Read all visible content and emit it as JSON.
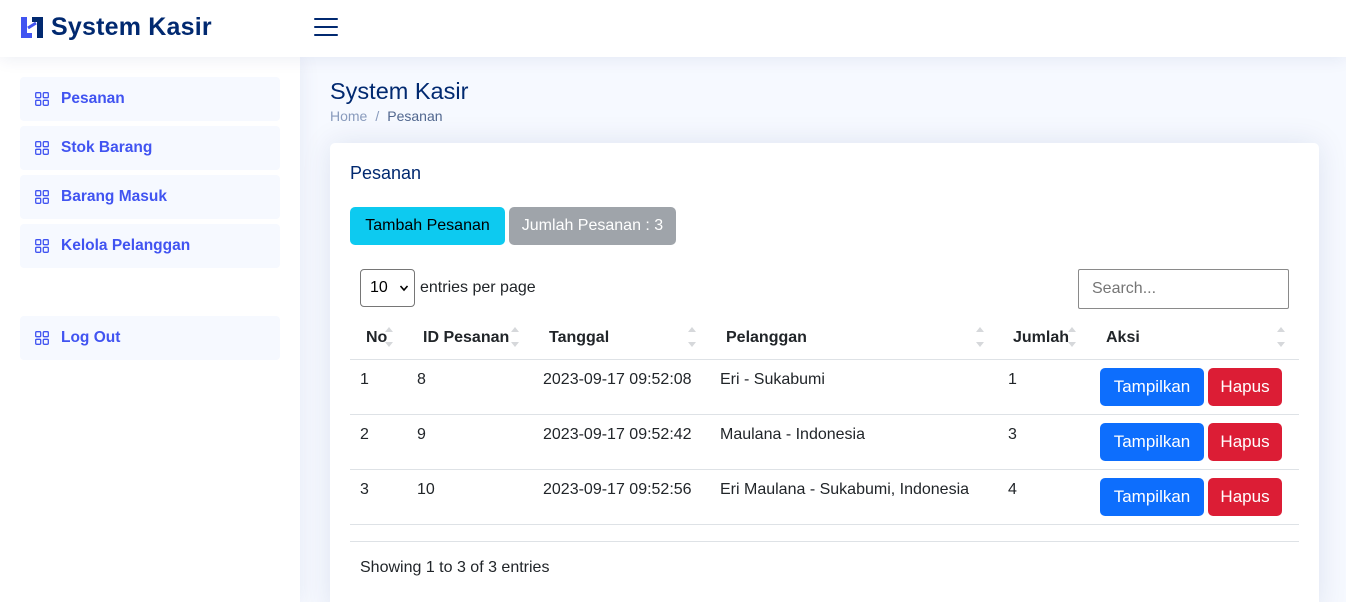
{
  "app": {
    "title": "System Kasir"
  },
  "sidebar": {
    "items": [
      {
        "label": "Pesanan"
      },
      {
        "label": "Stok Barang"
      },
      {
        "label": "Barang Masuk"
      },
      {
        "label": "Kelola Pelanggan"
      }
    ],
    "logout": {
      "label": "Log Out"
    }
  },
  "page": {
    "title": "System Kasir",
    "breadcrumb": {
      "home": "Home",
      "separator": "/",
      "current": "Pesanan"
    }
  },
  "card": {
    "title": "Pesanan",
    "add_button": "Tambah Pesanan",
    "count_badge": "Jumlah Pesanan : 3"
  },
  "table_controls": {
    "per_page_value": "10",
    "per_page_label": "entries per page",
    "search_placeholder": "Search..."
  },
  "table": {
    "headers": {
      "no": "No",
      "id": "ID Pesanan",
      "date": "Tanggal",
      "customer": "Pelanggan",
      "qty": "Jumlah",
      "action": "Aksi"
    },
    "rows": [
      {
        "no": "1",
        "id": "8",
        "date": "2023-09-17 09:52:08",
        "customer": "Eri - Sukabumi",
        "qty": "1",
        "show": "Tampilkan",
        "delete": "Hapus"
      },
      {
        "no": "2",
        "id": "9",
        "date": "2023-09-17 09:52:42",
        "customer": "Maulana - Indonesia",
        "qty": "3",
        "show": "Tampilkan",
        "delete": "Hapus"
      },
      {
        "no": "3",
        "id": "10",
        "date": "2023-09-17 09:52:56",
        "customer": "Eri Maulana - Sukabumi, Indonesia",
        "qty": "4",
        "show": "Tampilkan",
        "delete": "Hapus"
      }
    ]
  },
  "footer": {
    "info": "Showing 1 to 3 of 3 entries"
  },
  "icons": {
    "logo": "logo-icon",
    "menu": "hamburger-menu-icon",
    "nav": "grid-icon",
    "select": "chevron-down-icon",
    "sort": "sort-icon"
  },
  "colors": {
    "brand": "#012970",
    "accent": "#4154f1",
    "info": "#0dcaf0",
    "secondary": "#9aa0a6",
    "primary": "#0d6efd",
    "danger": "#dc1d35"
  }
}
